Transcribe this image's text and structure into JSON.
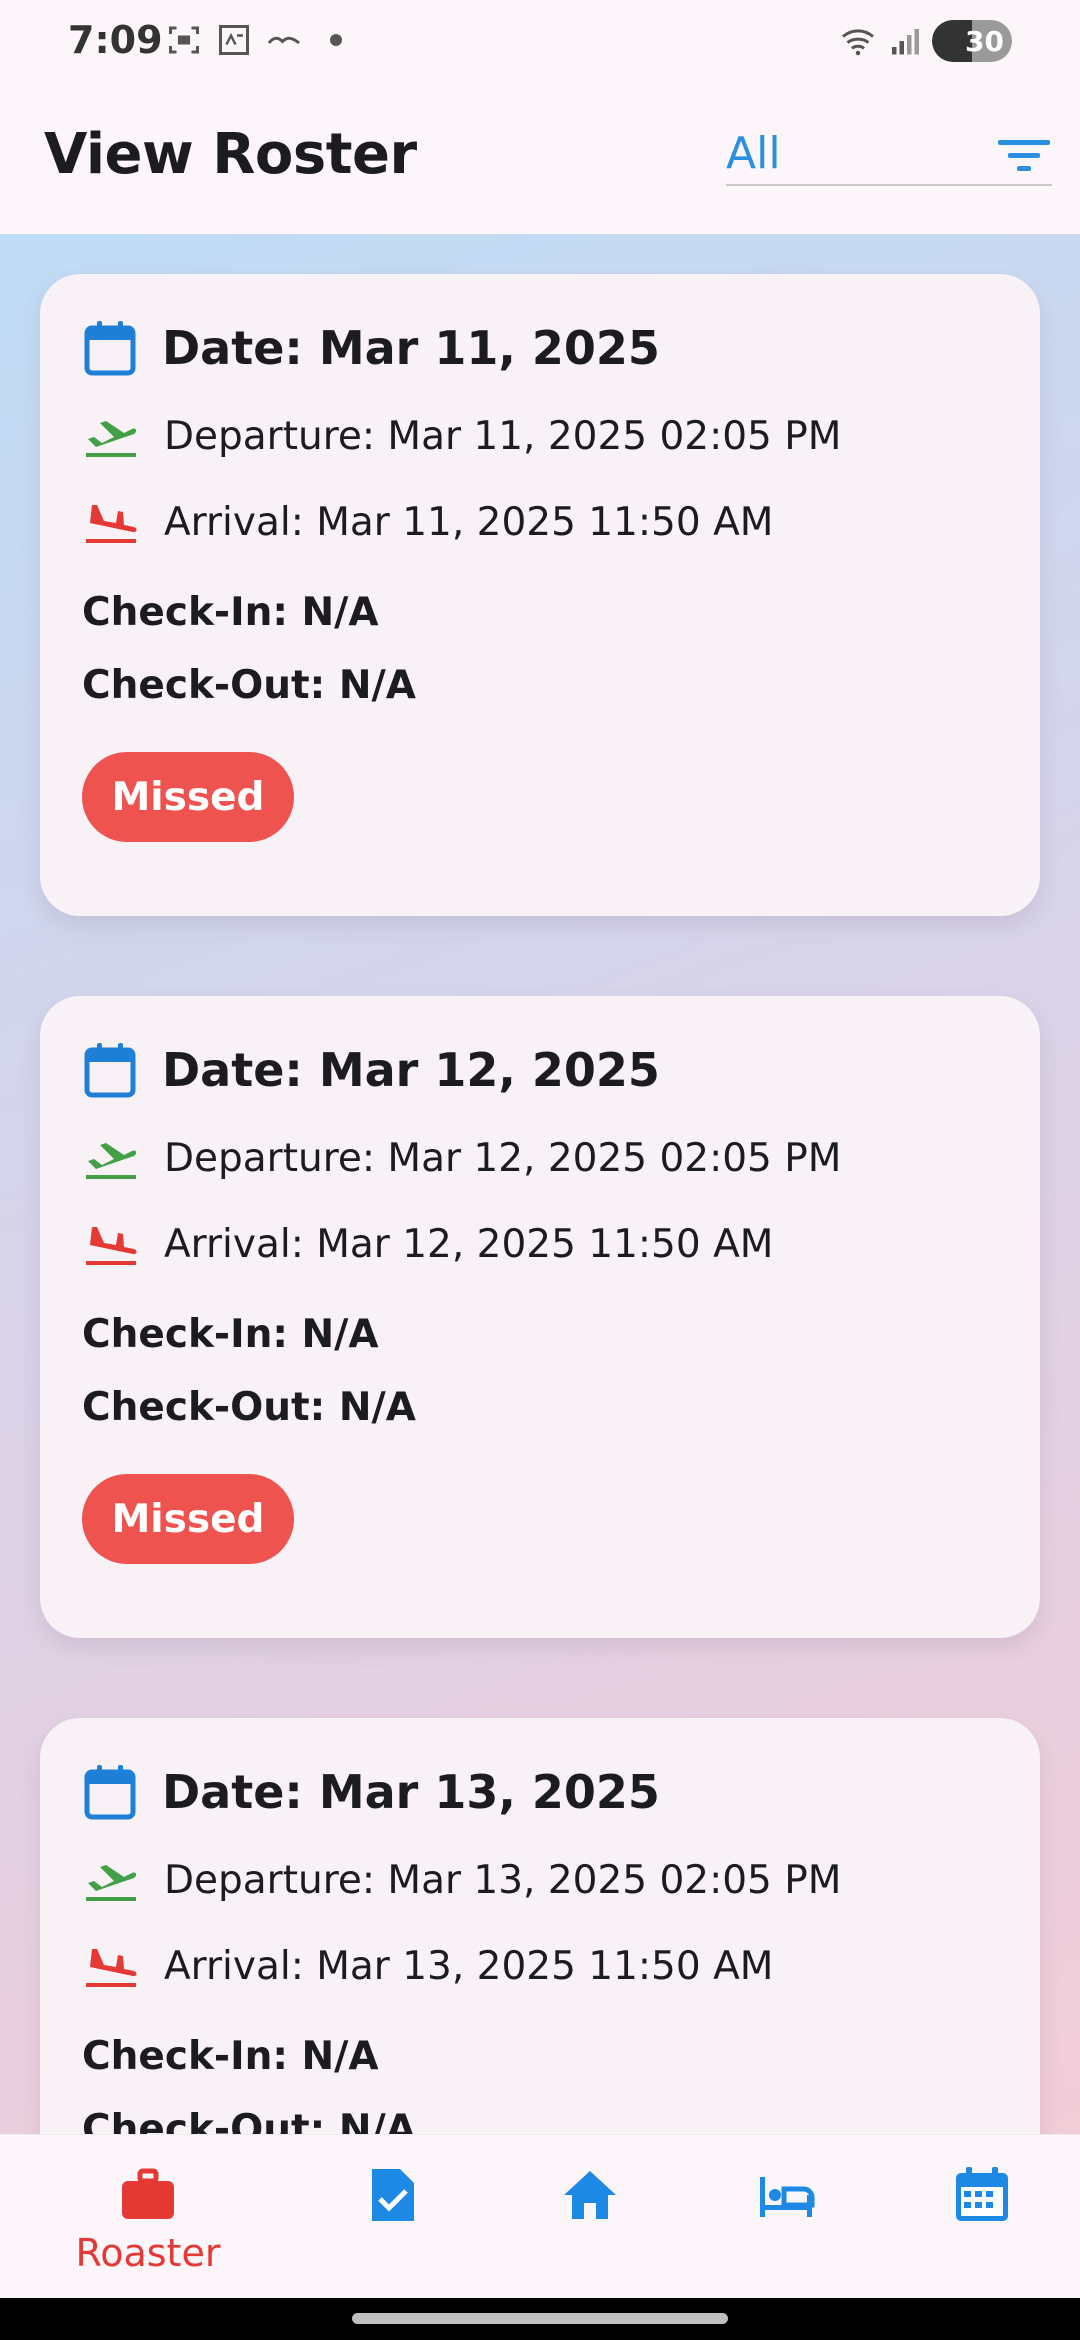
{
  "status_bar": {
    "time": "7:09",
    "battery": "30"
  },
  "header": {
    "title": "View Roster",
    "filter_value": "All"
  },
  "cards": [
    {
      "date": "Date: Mar 11, 2025",
      "departure": "Departure: Mar 11, 2025 02:05 PM",
      "arrival": "Arrival: Mar 11, 2025 11:50 AM",
      "check_in": "Check-In: N/A",
      "check_out": "Check-Out: N/A",
      "status": "Missed"
    },
    {
      "date": "Date: Mar 12, 2025",
      "departure": "Departure: Mar 12, 2025 02:05 PM",
      "arrival": "Arrival: Mar 12, 2025 11:50 AM",
      "check_in": "Check-In: N/A",
      "check_out": "Check-Out: N/A",
      "status": "Missed"
    },
    {
      "date": "Date: Mar 13, 2025",
      "departure": "Departure: Mar 13, 2025 02:05 PM",
      "arrival": "Arrival: Mar 13, 2025 11:50 AM",
      "check_in": "Check-In: N/A",
      "check_out": "Check-Out: N/A"
    }
  ],
  "bottom_nav": {
    "items": [
      {
        "icon": "briefcase-icon",
        "label": "Roaster",
        "active": true
      },
      {
        "icon": "task-check-icon"
      },
      {
        "icon": "home-icon"
      },
      {
        "icon": "hotel-bed-icon"
      },
      {
        "icon": "calendar-icon"
      }
    ]
  },
  "colors": {
    "accent_blue": "#2a8fe0",
    "calendar_blue": "#1e7fd6",
    "departure_green": "#43a047",
    "arrival_red": "#e53935",
    "missed_badge": "#ef5350",
    "active_nav": "#e53935"
  }
}
